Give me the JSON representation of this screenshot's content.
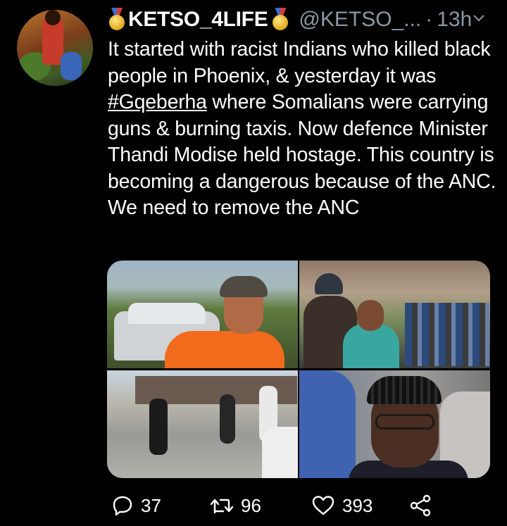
{
  "tweet": {
    "display_name": "KETSO_4LIFE",
    "handle": "@KETSO_...",
    "separator": "·",
    "time": "13h",
    "text_before": "It started with racist Indians who killed black people in Phoenix, & yesterday it was ",
    "hashtag": "#Gqeberha",
    "text_after": " where Somalians were carrying guns & burning taxis. Now defence Minister Thandi Modise held hostage. This country is becoming a dangerous because of the ANC. We need to remove the ANC"
  },
  "actions": {
    "replies": "37",
    "retweets": "96",
    "likes": "393"
  },
  "icons": {
    "name_badge": "gold-medal-icon",
    "menu": "chevron-down-icon",
    "reply": "reply-icon",
    "retweet": "retweet-icon",
    "like": "heart-icon",
    "share": "share-icon"
  },
  "colors": {
    "background": "#000000",
    "text": "#ffffff",
    "secondary": "#8b98a5"
  }
}
